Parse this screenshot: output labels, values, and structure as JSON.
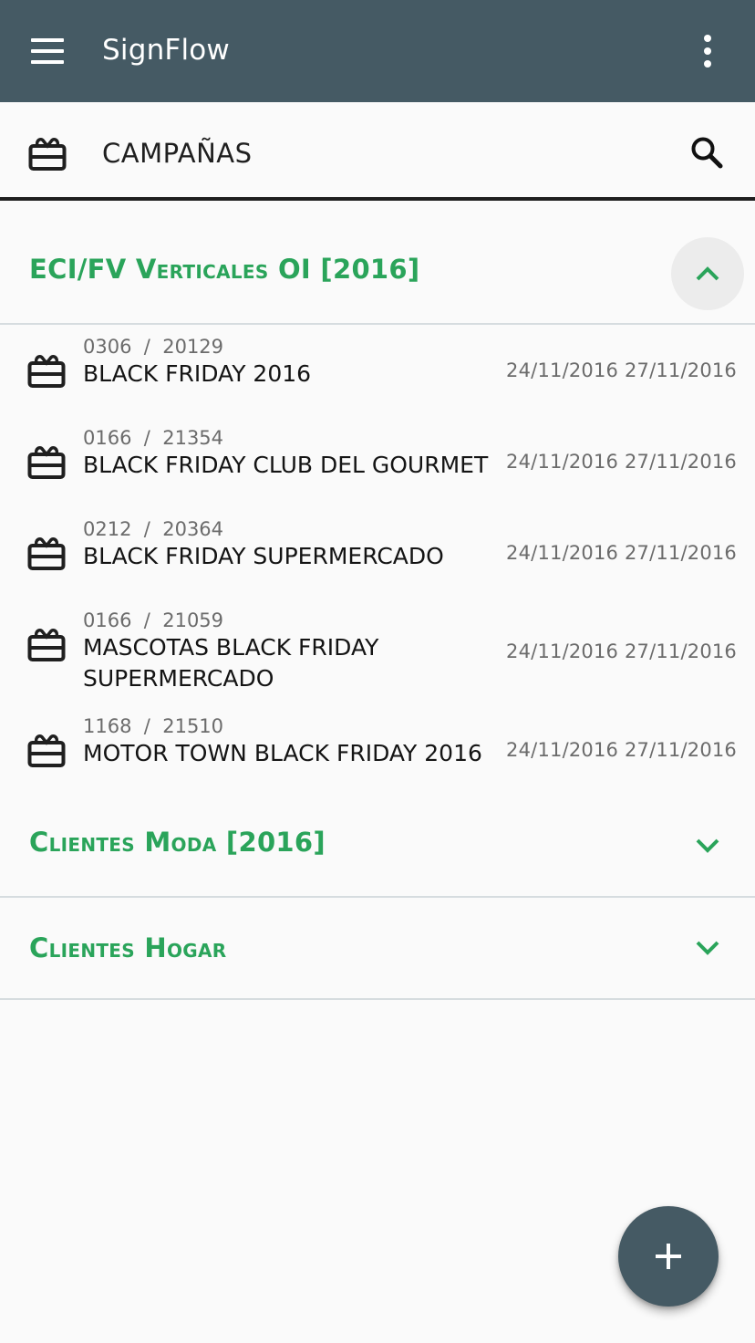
{
  "app": {
    "title": "SignFlow"
  },
  "appbar": {
    "menu_icon": "menu-icon",
    "more_icon": "more-vertical-icon"
  },
  "section": {
    "title": "CAMPAÑAS",
    "icon": "campaign-icon",
    "search_icon": "search-icon"
  },
  "groups": [
    {
      "title": "ECI/FV Verticales OI [2016]",
      "expanded": true,
      "items": [
        {
          "code": "0306  /  20129",
          "name": "BLACK FRIDAY 2016",
          "dates": "24/11/2016 27/11/2016"
        },
        {
          "code": "0166  /  21354",
          "name": "BLACK FRIDAY CLUB DEL GOURMET",
          "dates": "24/11/2016 27/11/2016"
        },
        {
          "code": "0212  /  20364",
          "name": "BLACK FRIDAY SUPERMERCADO",
          "dates": "24/11/2016 27/11/2016"
        },
        {
          "code": "0166  /  21059",
          "name": "MASCOTAS BLACK FRIDAY SUPERMERCADO",
          "dates": "24/11/2016 27/11/2016"
        },
        {
          "code": "1168  /  21510",
          "name": "MOTOR TOWN BLACK FRIDAY 2016",
          "dates": "24/11/2016 27/11/2016"
        }
      ]
    },
    {
      "title": "Clientes Moda [2016]",
      "expanded": false,
      "items": []
    },
    {
      "title": "Clientes Hogar",
      "expanded": false,
      "items": []
    }
  ],
  "fab": {
    "icon": "add-icon"
  },
  "colors": {
    "primary": "#455a64",
    "accent": "#2aa45a",
    "background": "#fafafa"
  }
}
